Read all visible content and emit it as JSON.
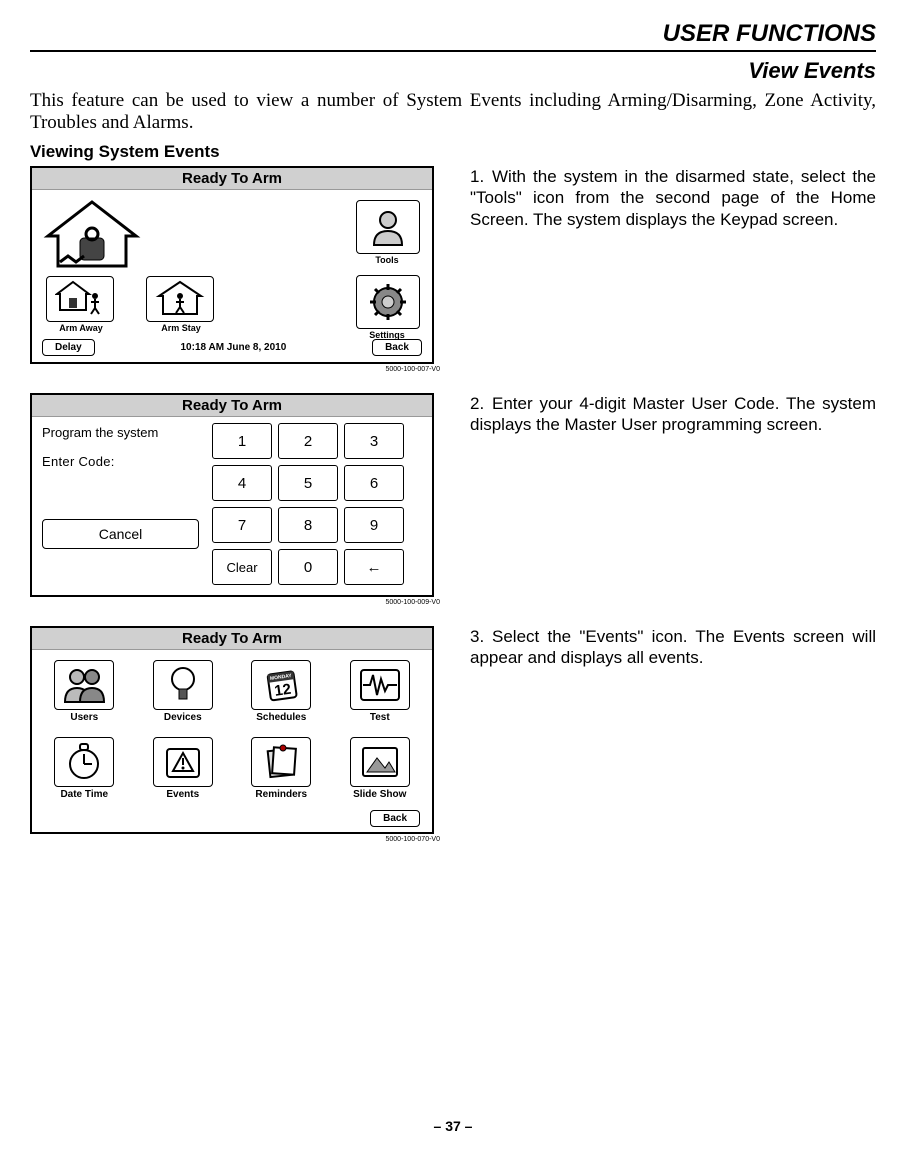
{
  "header": {
    "title": "USER FUNCTIONS",
    "subtitle": "View Events"
  },
  "intro": "This feature can be used to view a number of System Events including Arming/Disarming, Zone Activity, Troubles and Alarms.",
  "section_head": "Viewing System Events",
  "steps": [
    "With the system in the disarmed state, select the \"Tools\" icon from the second page of the Home Screen. The system displays the Keypad screen.",
    "Enter your 4-digit Master User Code. The system displays the Master User programming screen.",
    "Select the \"Events\" icon. The Events screen will appear and displays all events."
  ],
  "panel1": {
    "title": "Ready To Arm",
    "tools": "Tools",
    "arm_away": "Arm Away",
    "arm_stay": "Arm Stay",
    "settings": "Settings",
    "delay": "Delay",
    "datetime": "10:18 AM  June 8,  2010",
    "back": "Back",
    "fig": "5000-100-007-V0"
  },
  "panel2": {
    "title": "Ready To Arm",
    "program": "Program the system",
    "enter": "Enter Code:",
    "cancel": "Cancel",
    "keys": [
      "1",
      "2",
      "3",
      "4",
      "5",
      "6",
      "7",
      "8",
      "9",
      "Clear",
      "0",
      "←"
    ],
    "fig": "5000-100-009-V0"
  },
  "panel3": {
    "title": "Ready To Arm",
    "items": [
      "Users",
      "Devices",
      "Schedules",
      "Test",
      "Date Time",
      "Events",
      "Reminders",
      "Slide Show"
    ],
    "back": "Back",
    "fig": "5000-100-070-V0"
  },
  "page_num": "– 37 –"
}
